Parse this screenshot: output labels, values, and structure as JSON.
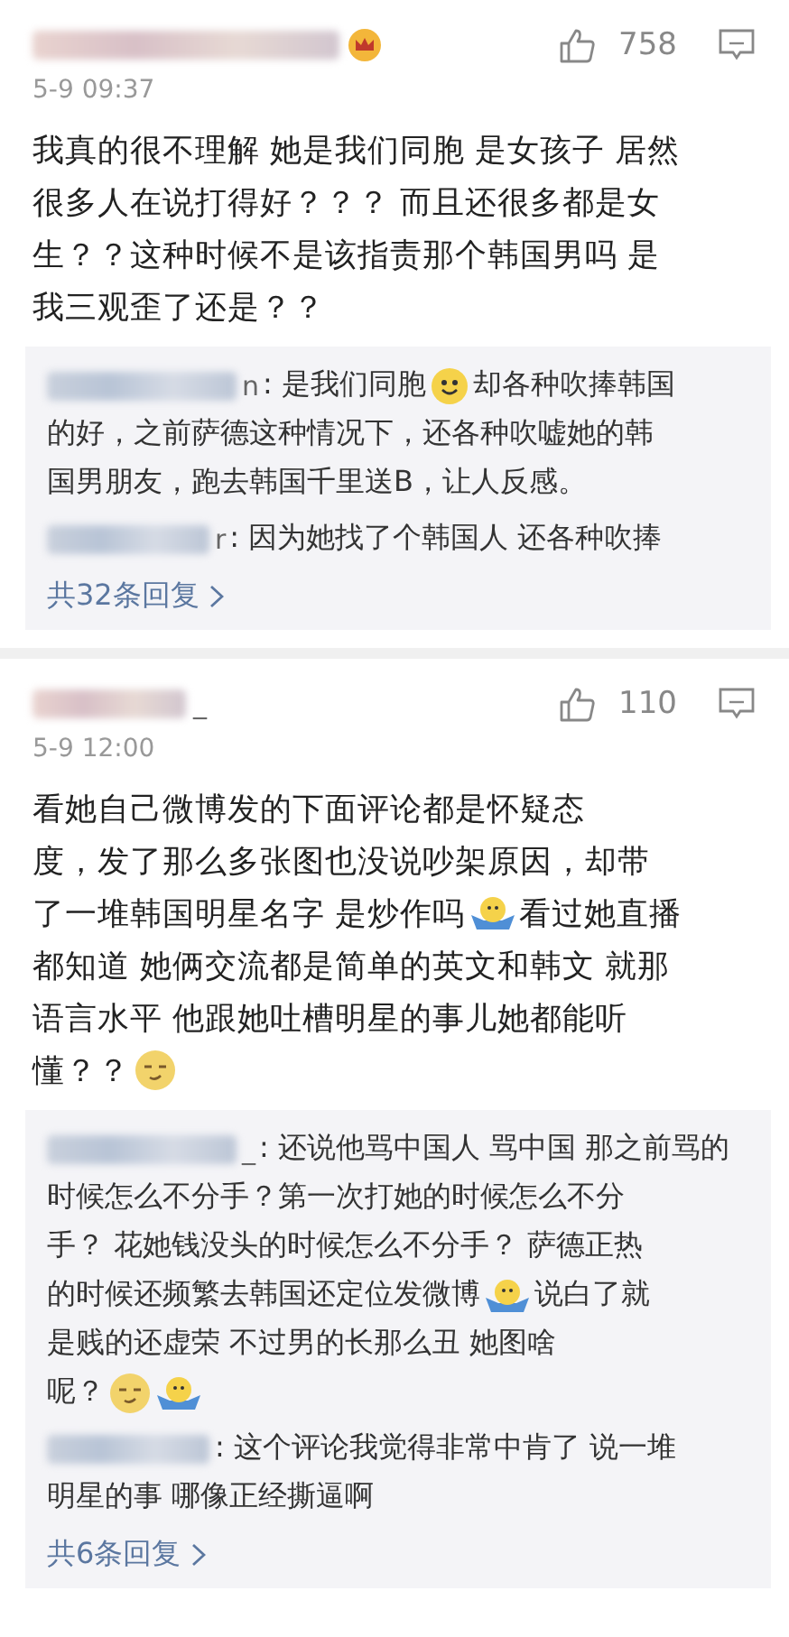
{
  "comments": [
    {
      "badge": true,
      "likes": "758",
      "time": "5-9 09:37",
      "lines": [
        "我真的很不理解 她是我们同胞 是女孩子 居然",
        "很多人在说打得好？？？ 而且还很多都是女",
        "生？？这种时候不是该指责那个韩国男吗 是",
        "我三观歪了还是？？"
      ],
      "replies": [
        {
          "author_visible": "n",
          "lines": [
            [
              {
                "kind": "text",
                "text": ": 是我们同胞"
              },
              {
                "kind": "smile"
              },
              {
                "kind": "text",
                "text": "却各种吹捧韩国"
              }
            ],
            "的好，之前萨德这种情况下，还各种吹嘘她的韩",
            "国男朋友，跑去韩国千里送B，让人反感。"
          ]
        },
        {
          "author_visible": "r",
          "lines": [
            ": 因为她找了个韩国人 还各种吹捧"
          ]
        }
      ],
      "more": "共32条回复"
    },
    {
      "author_visible": "_",
      "badge": false,
      "likes": "110",
      "time": "5-9 12:00",
      "lines": [
        "看她自己微博发的下面评论都是怀疑态",
        "度，发了那么多张图也没说吵架原因，却带",
        [
          {
            "kind": "text",
            "text": "了一堆韩国明星名字 是炒作吗"
          },
          {
            "kind": "shrug"
          },
          {
            "kind": "text",
            "text": "看过她直播"
          }
        ],
        "都知道 她俩交流都是简单的英文和韩文 就那",
        "语言水平 他跟她吐槽明星的事儿她都能听",
        [
          {
            "kind": "text",
            "text": "懂？？"
          },
          {
            "kind": "smirk"
          }
        ]
      ],
      "replies": [
        {
          "author_visible": "_",
          "lines": [
            ": 还说他骂中国人 骂中国 那之前骂的",
            "时候怎么不分手？第一次打她的时候怎么不分",
            "手？ 花她钱没头的时候怎么不分手？ 萨德正热",
            [
              {
                "kind": "text",
                "text": "的时候还频繁去韩国还定位发微博"
              },
              {
                "kind": "shrug"
              },
              {
                "kind": "text",
                "text": "说白了就"
              }
            ],
            "是贱的还虚荣 不过男的长那么丑 她图啥",
            [
              {
                "kind": "text",
                "text": "呢？"
              },
              {
                "kind": "smirk"
              },
              {
                "kind": "shrug"
              }
            ]
          ]
        },
        {
          "lines": [
            ": 这个评论我觉得非常中肯了 说一堆",
            "明星的事 哪像正经撕逼啊"
          ]
        }
      ],
      "more": "共6条回复"
    }
  ]
}
